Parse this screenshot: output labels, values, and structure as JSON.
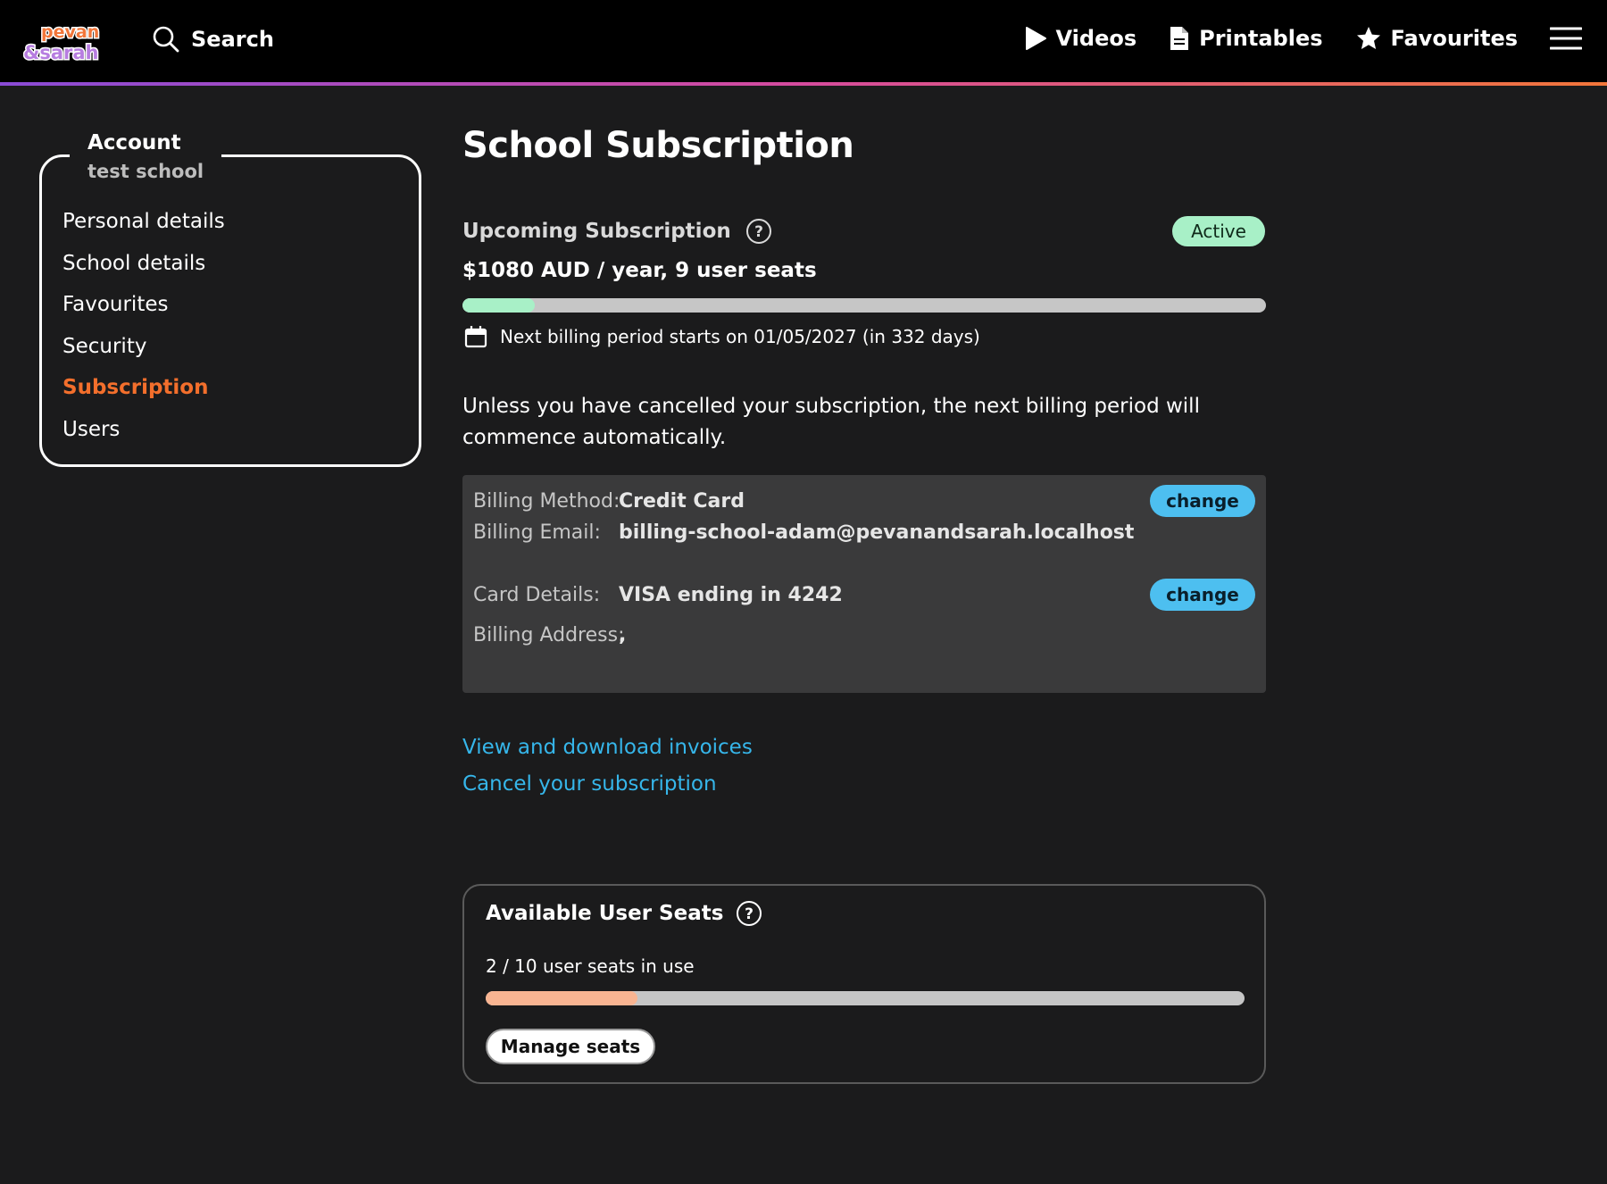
{
  "header": {
    "logo_text_top": "pevan",
    "logo_text_bottom": "&sarah",
    "search_label": "Search",
    "nav": [
      {
        "label": "Videos",
        "icon": "play-icon"
      },
      {
        "label": "Printables",
        "icon": "document-icon"
      },
      {
        "label": "Favourites",
        "icon": "star-icon"
      }
    ],
    "menu_icon": "hamburger-menu-icon",
    "accent_gradient": [
      "#8a4bd6",
      "#d64b9e",
      "#f2763a"
    ]
  },
  "sidebar": {
    "title": "Account",
    "subtitle": "test school",
    "items": [
      {
        "label": "Personal details"
      },
      {
        "label": "School details"
      },
      {
        "label": "Favourites"
      },
      {
        "label": "Security"
      },
      {
        "label": "Subscription",
        "active": true
      },
      {
        "label": "Users"
      }
    ],
    "active_color": "#f36f2c"
  },
  "main": {
    "title": "School Subscription",
    "subscription": {
      "heading": "Upcoming Subscription",
      "status": "Active",
      "status_color": "#a8f0c7",
      "plan": "$1080 AUD / year, 9 user seats",
      "progress_fraction": 0.09,
      "progress_color": "#a8f0c7",
      "next_billing": "Next billing period starts on 01/05/2027 (in 332 days)"
    },
    "notice": "Unless you have cancelled your subscription, the next billing period will commence automatically.",
    "billing": {
      "method_label": "Billing Method:",
      "method_value": "Credit Card",
      "email_label": "Billing Email:",
      "email_value": "billing-school-adam@pevanandsarah.localhost",
      "card_label": "Card Details:",
      "card_value": "VISA ending in 4242",
      "address_label_1": "Billing",
      "address_label_2": "Address:",
      "address_value": ",",
      "change_label": "change",
      "button_color": "#4dbff0"
    },
    "links": {
      "invoices": "View and download invoices",
      "cancel": "Cancel your subscription",
      "color": "#36b6ea"
    },
    "seats": {
      "heading": "Available User Seats",
      "usage": "2 / 10 user seats in use",
      "used": 2,
      "total": 10,
      "fill_color": "#f9b592",
      "manage_label": "Manage seats"
    }
  }
}
